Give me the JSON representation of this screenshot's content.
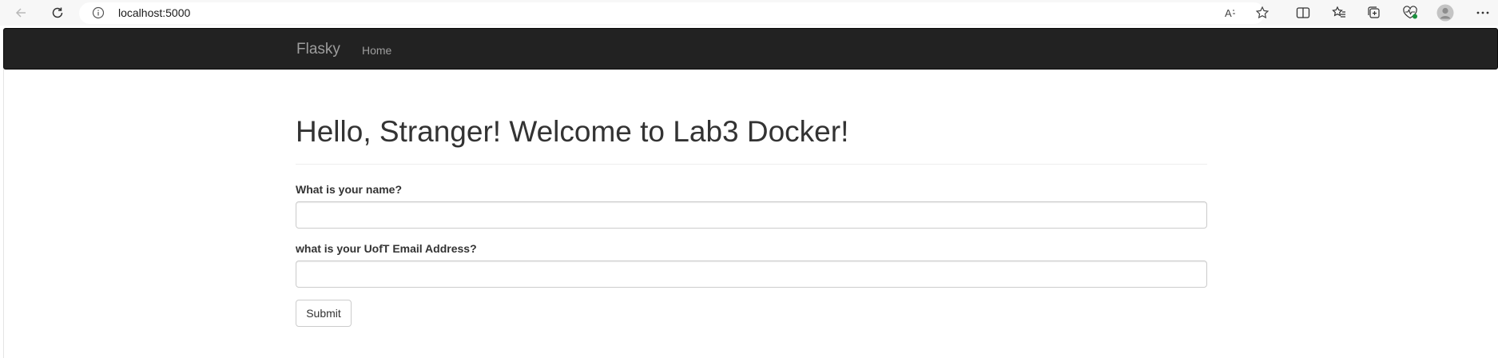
{
  "browser": {
    "url": "localhost:5000",
    "icons": [
      "back-icon",
      "refresh-icon",
      "site-info-icon",
      "read-aloud-icon",
      "favorite-star-icon",
      "split-screen-icon",
      "favorites-icon",
      "collections-icon",
      "browser-essentials-icon",
      "profile-avatar-icon",
      "more-menu-icon"
    ]
  },
  "navbar": {
    "brand": "Flasky",
    "links": [
      {
        "label": "Home"
      }
    ],
    "background": "#222222",
    "text_color": "#9d9d9d"
  },
  "main": {
    "title": "Hello, Stranger! Welcome to Lab3 Docker!",
    "form": {
      "name_label": "What is your name?",
      "name_value": "",
      "email_label": "what is your UofT Email Address?",
      "email_value": "",
      "submit_label": "Submit"
    }
  }
}
